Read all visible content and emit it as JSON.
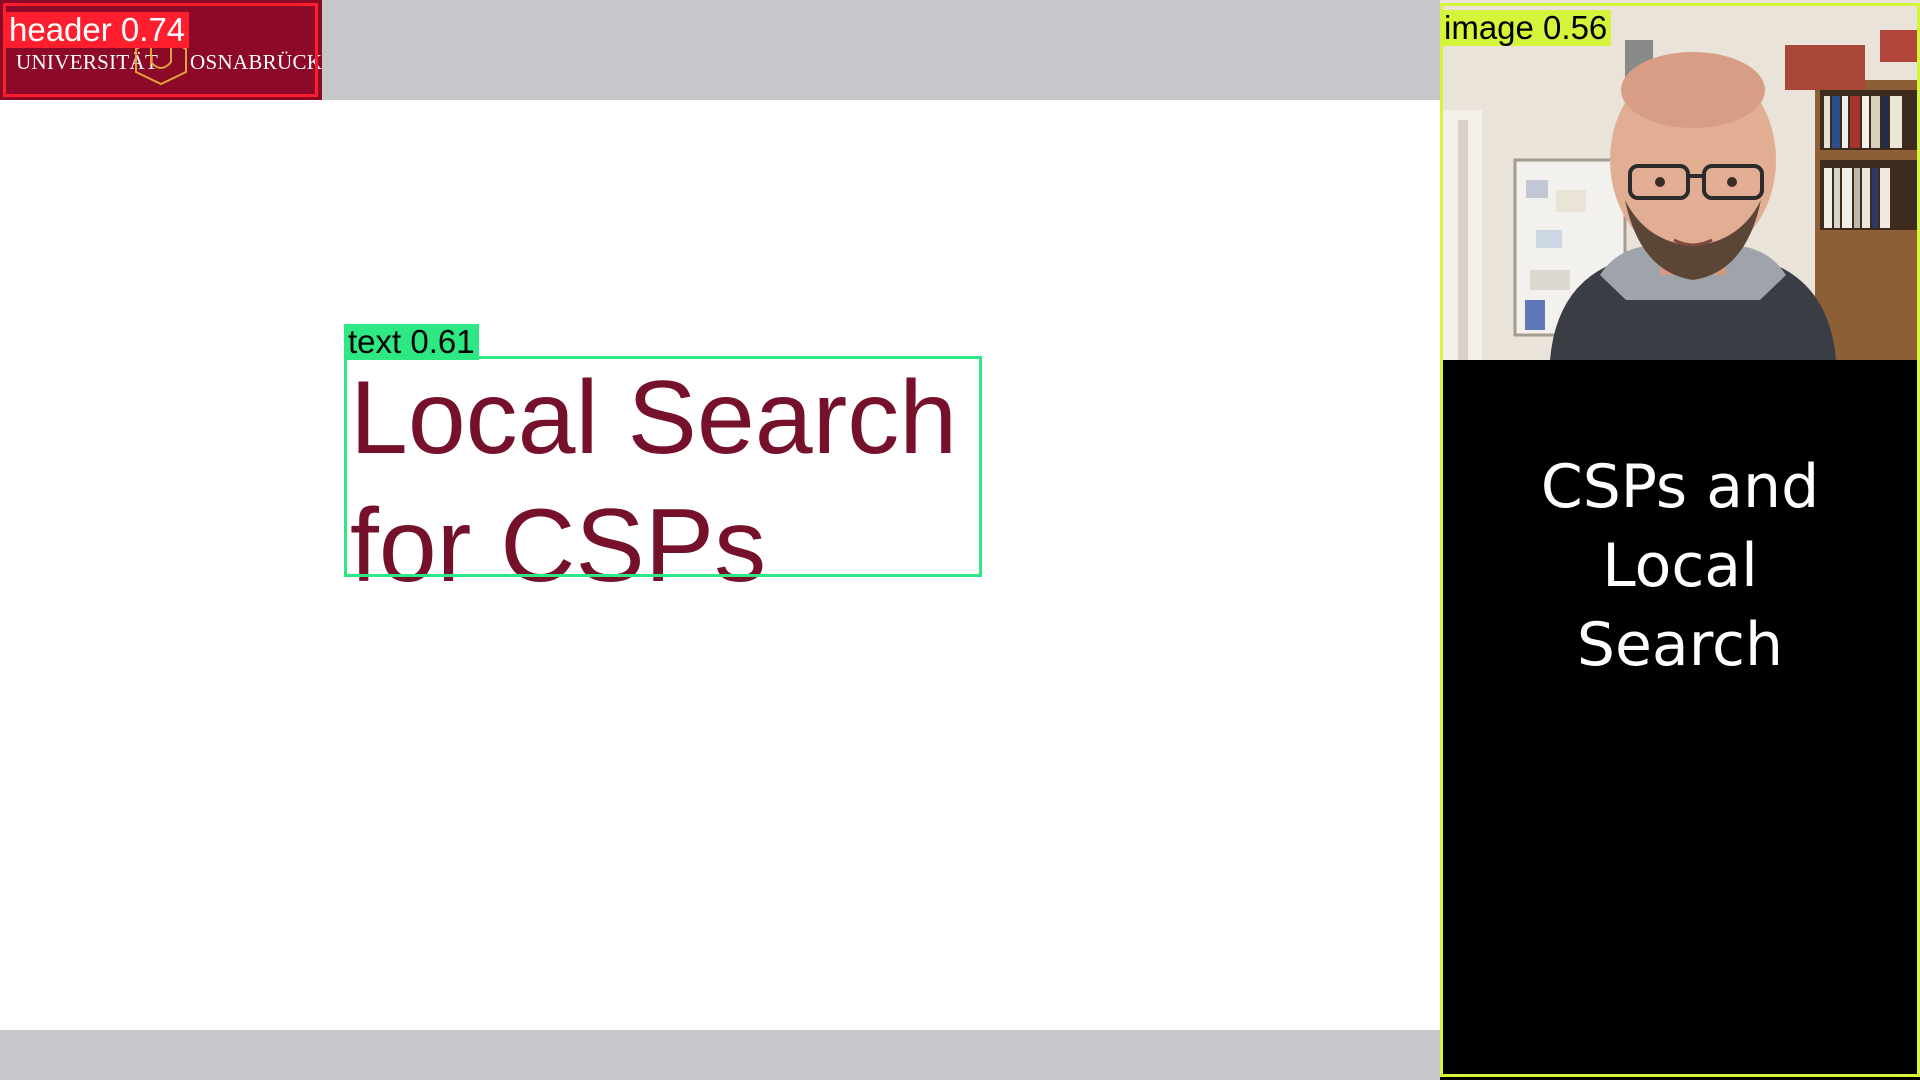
{
  "header": {
    "logo_left": "UNIVERSITÄT",
    "logo_right": "OSNABRÜCK"
  },
  "slide": {
    "title_line1": "Local Search",
    "title_line2": "for CSPs"
  },
  "sidebar": {
    "title_line1": "CSPs and",
    "title_line2": "Local",
    "title_line3": "Search"
  },
  "detections": {
    "header_label": "header 0.74",
    "text_label": "text 0.61",
    "image_label": "image 0.56"
  },
  "colors": {
    "brand": "#8c0a28",
    "title": "#76112b",
    "band": "#c6c7ca",
    "det_header": "#ff1e2d",
    "det_text": "#2ee883",
    "det_image": "#d4f53a"
  }
}
